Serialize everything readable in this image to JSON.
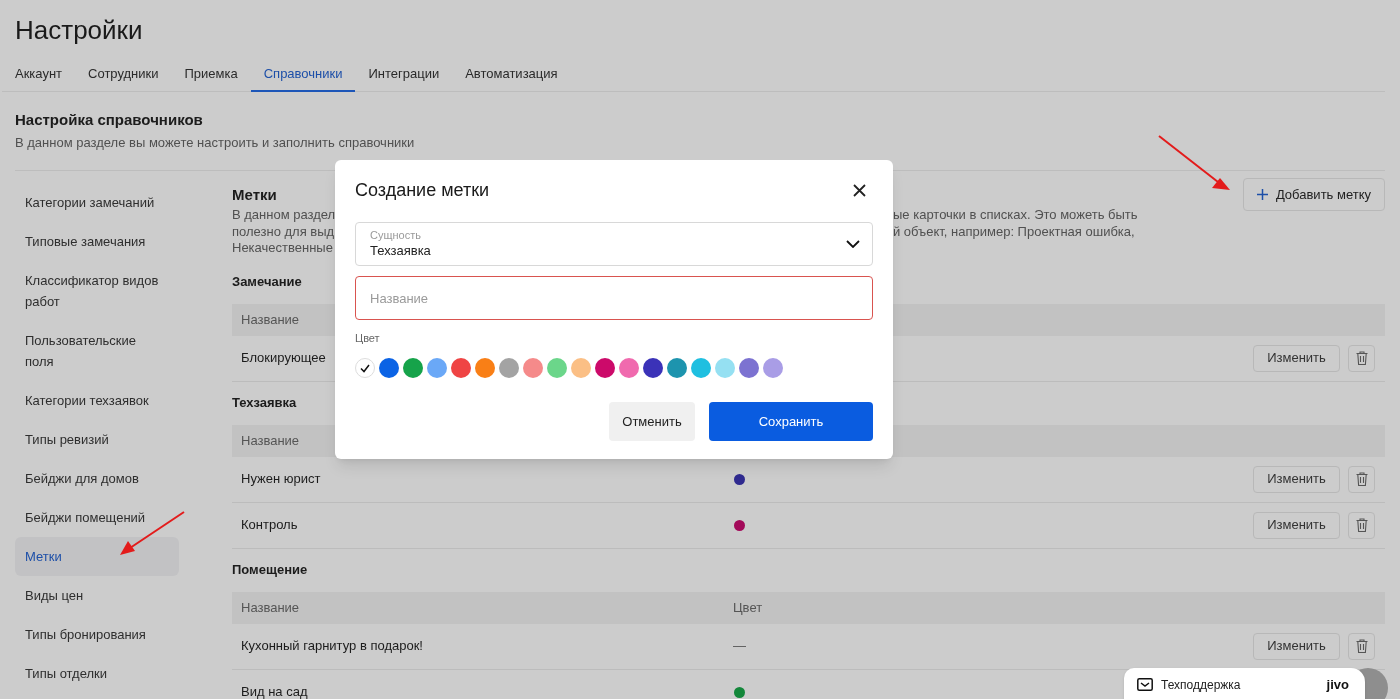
{
  "page": {
    "title": "Настройки"
  },
  "tabs": [
    {
      "label": "Аккаунт",
      "selected": false
    },
    {
      "label": "Сотрудники",
      "selected": false
    },
    {
      "label": "Приемка",
      "selected": false
    },
    {
      "label": "Справочники",
      "selected": true
    },
    {
      "label": "Интеграции",
      "selected": false
    },
    {
      "label": "Автоматизация",
      "selected": false
    }
  ],
  "section": {
    "title": "Настройка справочников",
    "subtitle": "В данном разделе вы можете настроить и заполнить справочники"
  },
  "sidebar": {
    "items": [
      {
        "label": "Категории замечаний",
        "selected": false
      },
      {
        "label": "Типовые замечания",
        "selected": false
      },
      {
        "label": "Классификатор видов работ",
        "selected": false
      },
      {
        "label": "Пользовательские поля",
        "selected": false
      },
      {
        "label": "Категории техзаявок",
        "selected": false
      },
      {
        "label": "Типы ревизий",
        "selected": false
      },
      {
        "label": "Бейджи для домов",
        "selected": false
      },
      {
        "label": "Бейджи помещений",
        "selected": false
      },
      {
        "label": "Метки",
        "selected": true
      },
      {
        "label": "Виды цен",
        "selected": false
      },
      {
        "label": "Типы бронирования",
        "selected": false
      },
      {
        "label": "Типы отделки",
        "selected": false
      }
    ]
  },
  "content": {
    "title": "Метки",
    "add_button": "Добавить метку",
    "description_left": [
      "В данном раздел",
      "полезно для выд",
      "Некачественные"
    ],
    "description_right": [
      "ые карточки в списках. Это можеть быть",
      "й объект, например: Проектная ошибка,"
    ],
    "groups": [
      {
        "title": "Замечание",
        "columns": [
          "Название"
        ],
        "rows": [
          {
            "name": "Блокирующее",
            "edit": "Изменить"
          }
        ]
      },
      {
        "title": "Техзаявка",
        "columns": [
          "Название"
        ],
        "rows": [
          {
            "name": "Нужен юрист",
            "color": "#2f2a8f",
            "edit": "Изменить"
          },
          {
            "name": "Контроль",
            "color": "#a30a5a",
            "edit": "Изменить"
          }
        ]
      },
      {
        "title": "Помещение",
        "columns": [
          "Название",
          "Цвет"
        ],
        "rows": [
          {
            "name": "Кухонный гарнитур в подарок!",
            "color_text": "—",
            "edit": "Изменить"
          },
          {
            "name": "Вид на сад",
            "color": "#13873a"
          }
        ]
      }
    ]
  },
  "dialog": {
    "title": "Создание метки",
    "entity": {
      "label": "Сущность",
      "value": "Техзаявка"
    },
    "name": {
      "placeholder": "Название",
      "invalid": true
    },
    "color_label": "Цвет",
    "colors": [
      {
        "color": "#ffffff",
        "selected": true
      },
      {
        "color": "#0b63e5",
        "selected": false
      },
      {
        "color": "#16a34a",
        "selected": false
      },
      {
        "color": "#6aa8f7",
        "selected": false
      },
      {
        "color": "#ef4444",
        "selected": false
      },
      {
        "color": "#f97f16",
        "selected": false
      },
      {
        "color": "#a3a3a3",
        "selected": false
      },
      {
        "color": "#f58a8a",
        "selected": false
      },
      {
        "color": "#6bd68a",
        "selected": false
      },
      {
        "color": "#fbbf85",
        "selected": false
      },
      {
        "color": "#cc0a6a",
        "selected": false
      },
      {
        "color": "#f06aae",
        "selected": false
      },
      {
        "color": "#3b32b8",
        "selected": false
      },
      {
        "color": "#1d94ae",
        "selected": false
      },
      {
        "color": "#1fbfe0",
        "selected": false
      },
      {
        "color": "#95e0f2",
        "selected": false
      },
      {
        "color": "#7c72d1",
        "selected": false
      },
      {
        "color": "#a99de6",
        "selected": false
      }
    ],
    "buttons": [
      {
        "label": "Отменить",
        "kind": "secondary"
      },
      {
        "label": "Сохранить",
        "kind": "primary"
      }
    ]
  },
  "support_widget": {
    "label": "Техподдержка",
    "brand": "jivo"
  }
}
